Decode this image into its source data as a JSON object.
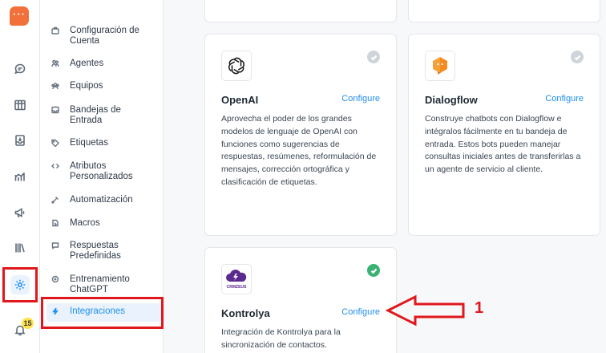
{
  "rail": {
    "logo_dots": "···",
    "icons": [
      "chat-icon",
      "kanban-icon",
      "inbox-icon",
      "reports-icon",
      "campaigns-icon",
      "library-icon",
      "settings-icon",
      "bell-icon"
    ],
    "notification_count": "15"
  },
  "sidebar": {
    "items": [
      {
        "label": "Configuración de Cuenta",
        "icon": "briefcase-icon"
      },
      {
        "label": "Agentes",
        "icon": "people-icon"
      },
      {
        "label": "Equipos",
        "icon": "team-icon"
      },
      {
        "label": "Bandejas de Entrada",
        "icon": "inbox-icon"
      },
      {
        "label": "Etiquetas",
        "icon": "tag-icon"
      },
      {
        "label": "Atributos Personalizados",
        "icon": "code-icon"
      },
      {
        "label": "Automatización",
        "icon": "automation-icon"
      },
      {
        "label": "Macros",
        "icon": "macro-icon"
      },
      {
        "label": "Respuestas Predefinidas",
        "icon": "chat-bubble-icon"
      },
      {
        "label": "Entrenamiento ChatGPT",
        "icon": "ai-icon"
      },
      {
        "label": "Integraciones",
        "icon": "flash-icon",
        "active": true
      }
    ]
  },
  "cards": {
    "openai": {
      "title": "OpenAI",
      "configure": "Configure",
      "description": "Aprovecha el poder de los grandes modelos de lenguaje de OpenAI con funciones como sugerencias de respuestas, resúmenes, reformulación de mensajes, corrección ortográfica y clasificación de etiquetas.",
      "enabled": false
    },
    "dialogflow": {
      "title": "Dialogflow",
      "configure": "Configure",
      "description": "Construye chatbots con Dialogflow e intégralos fácilmente en tu bandeja de entrada. Estos bots pueden manejar consultas iniciales antes de transferirlas a un agente de servicio al cliente.",
      "enabled": false
    },
    "kontrolya": {
      "title": "Kontrolya",
      "configure": "Configure",
      "description": "Integración de Kontrolya para la sincronización de contactos.",
      "logo_text": "CRMZEUS",
      "enabled": true
    }
  },
  "annotation": {
    "number": "1",
    "color": "#e0181c"
  },
  "colors": {
    "accent": "#1f8ef1",
    "brand": "#f2703a",
    "success": "#3bb273"
  }
}
